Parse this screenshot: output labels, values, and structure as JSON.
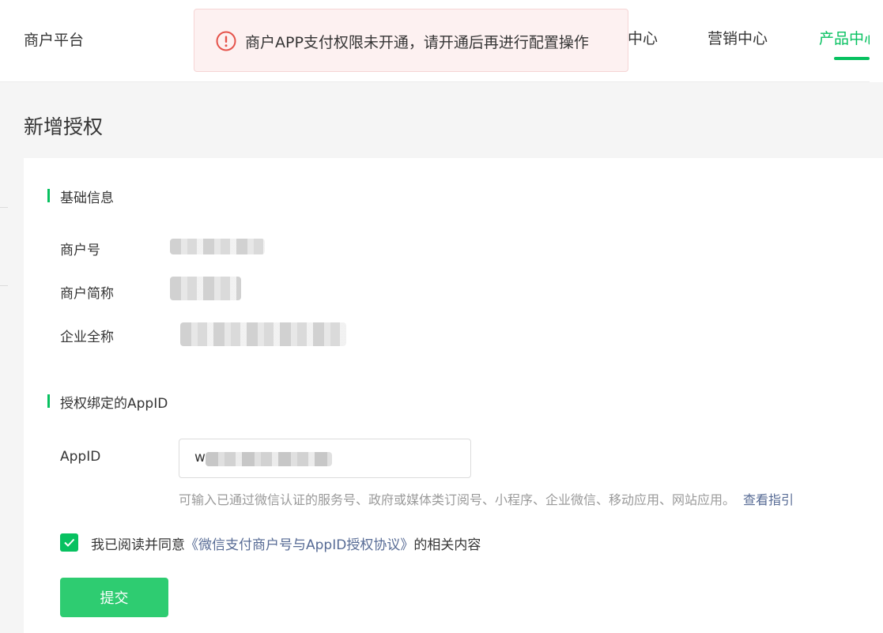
{
  "header": {
    "brand": "商户平台",
    "nav": [
      {
        "label": "中心"
      },
      {
        "label": "营销中心"
      },
      {
        "label": "产品中心"
      }
    ],
    "active_color": "#07c160"
  },
  "toast": {
    "icon": "error-circle-icon",
    "message": "商户APP支付权限未开通，请开通后再进行配置操作"
  },
  "page": {
    "title": "新增授权"
  },
  "basic_info": {
    "section_title": "基础信息",
    "merchant_id_label": "商户号",
    "merchant_short_label": "商户简称",
    "company_name_label": "企业全称"
  },
  "appid_section": {
    "section_title": "授权绑定的AppID",
    "appid_label": "AppID",
    "appid_value_visible": "w",
    "hint": "可输入已通过微信认证的服务号、政府或媒体类订阅号、小程序、企业微信、移动应用、网站应用。",
    "hint_link": "查看指引"
  },
  "agreement": {
    "checked": true,
    "prefix": "我已阅读并同意",
    "link": "《微信支付商户号与AppID授权协议》",
    "suffix": "的相关内容"
  },
  "submit_label": "提交"
}
